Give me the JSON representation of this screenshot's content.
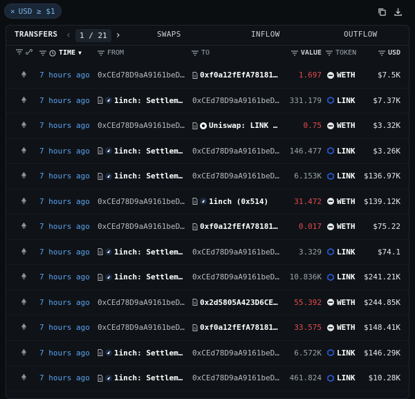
{
  "filter_chip": {
    "close": "×",
    "label": "USD ≥ $1"
  },
  "tabs": {
    "transfers": "TRANSFERS",
    "page": "1 / 21",
    "swaps": "SWAPS",
    "inflow": "INFLOW",
    "outflow": "OUTFLOW"
  },
  "columns": {
    "time": "TIME",
    "from": "FROM",
    "to": "TO",
    "value": "VALUE",
    "token": "TOKEN",
    "usd": "USD"
  },
  "rows": [
    {
      "time": "7 hours ago",
      "from": "0xCEd78D9aA9161beD…",
      "from_entity": false,
      "to": "0xf0a12fEfA78181…",
      "to_entity": true,
      "to_icon": "doc",
      "value": "1.697",
      "value_red": true,
      "token": "WETH",
      "usd": "$7.5K"
    },
    {
      "time": "7 hours ago",
      "from": "1inch: Settlem…",
      "from_entity": true,
      "to": "0xCEd78D9aA9161beD…",
      "to_entity": false,
      "value": "331.179",
      "value_red": false,
      "token": "LINK",
      "usd": "$7.37K"
    },
    {
      "time": "7 hours ago",
      "from": "0xCEd78D9aA9161beD…",
      "from_entity": false,
      "to": "Uniswap: LINK …",
      "to_entity": true,
      "to_icon": "uniswap",
      "value": "0.75",
      "value_red": true,
      "token": "WETH",
      "usd": "$3.32K"
    },
    {
      "time": "7 hours ago",
      "from": "1inch: Settlem…",
      "from_entity": true,
      "to": "0xCEd78D9aA9161beD…",
      "to_entity": false,
      "value": "146.477",
      "value_red": false,
      "token": "LINK",
      "usd": "$3.26K"
    },
    {
      "time": "7 hours ago",
      "from": "1inch: Settlem…",
      "from_entity": true,
      "to": "0xCEd78D9aA9161beD…",
      "to_entity": false,
      "value": "6.153K",
      "value_red": false,
      "token": "LINK",
      "usd": "$136.97K"
    },
    {
      "time": "7 hours ago",
      "from": "0xCEd78D9aA9161beD…",
      "from_entity": false,
      "to": "1inch (0x514)",
      "to_entity": true,
      "to_icon": "1inch",
      "value": "31.472",
      "value_red": true,
      "token": "WETH",
      "usd": "$139.12K"
    },
    {
      "time": "7 hours ago",
      "from": "0xCEd78D9aA9161beD…",
      "from_entity": false,
      "to": "0xf0a12fEfA78181…",
      "to_entity": true,
      "to_icon": "doc",
      "value": "0.017",
      "value_red": true,
      "token": "WETH",
      "usd": "$75.22"
    },
    {
      "time": "7 hours ago",
      "from": "1inch: Settlem…",
      "from_entity": true,
      "to": "0xCEd78D9aA9161beD…",
      "to_entity": false,
      "value": "3.329",
      "value_red": false,
      "token": "LINK",
      "usd": "$74.1"
    },
    {
      "time": "7 hours ago",
      "from": "1inch: Settlem…",
      "from_entity": true,
      "to": "0xCEd78D9aA9161beD…",
      "to_entity": false,
      "value": "10.836K",
      "value_red": false,
      "token": "LINK",
      "usd": "$241.21K"
    },
    {
      "time": "7 hours ago",
      "from": "0xCEd78D9aA9161beD…",
      "from_entity": false,
      "to": "0x2d5805A423D6CE…",
      "to_entity": true,
      "to_icon": "doc",
      "value": "55.392",
      "value_red": true,
      "token": "WETH",
      "usd": "$244.85K"
    },
    {
      "time": "7 hours ago",
      "from": "0xCEd78D9aA9161beD…",
      "from_entity": false,
      "to": "0xf0a12fEfA78181…",
      "to_entity": true,
      "to_icon": "doc",
      "value": "33.575",
      "value_red": true,
      "token": "WETH",
      "usd": "$148.41K"
    },
    {
      "time": "7 hours ago",
      "from": "1inch: Settlem…",
      "from_entity": true,
      "to": "0xCEd78D9aA9161beD…",
      "to_entity": false,
      "value": "6.572K",
      "value_red": false,
      "token": "LINK",
      "usd": "$146.29K"
    },
    {
      "time": "7 hours ago",
      "from": "1inch: Settlem…",
      "from_entity": true,
      "to": "0xCEd78D9aA9161beD…",
      "to_entity": false,
      "value": "461.824",
      "value_red": false,
      "token": "LINK",
      "usd": "$10.28K"
    }
  ],
  "colors": {
    "time_link": "#5aa2f0",
    "negative": "#e5484d",
    "link_token": "#2a5ada"
  }
}
